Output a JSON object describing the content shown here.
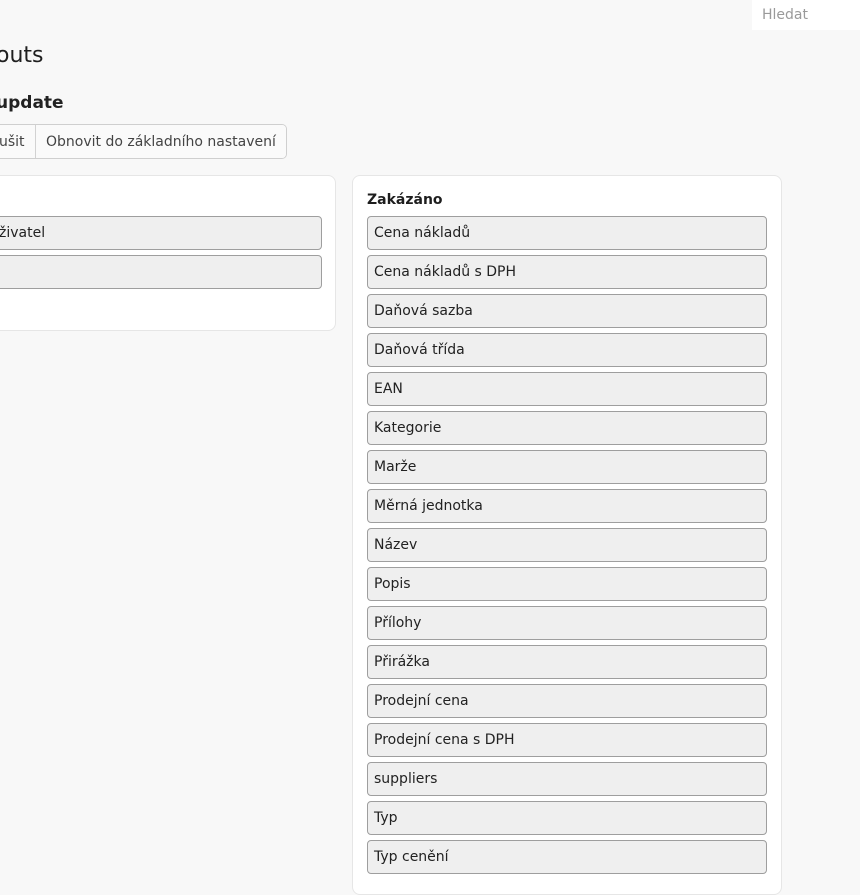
{
  "search": {
    "placeholder": "Hledat"
  },
  "page": {
    "title_fragment": "outs"
  },
  "section": {
    "title_fragment": "update"
  },
  "buttons": {
    "cancel_fragment": "ušit",
    "reset": "Obnovit do základního nastavení"
  },
  "enabled_panel": {
    "items": [
      "živatel",
      ""
    ]
  },
  "disabled_panel": {
    "title": "Zakázáno",
    "items": [
      "Cena nákladů",
      "Cena nákladů s DPH",
      "Daňová sazba",
      "Daňová třída",
      "EAN",
      "Kategorie",
      "Marže",
      "Měrná jednotka",
      "Název",
      "Popis",
      "Přílohy",
      "Přirážka",
      "Prodejní cena",
      "Prodejní cena s DPH",
      "suppliers",
      "Typ",
      "Typ cenění"
    ]
  }
}
